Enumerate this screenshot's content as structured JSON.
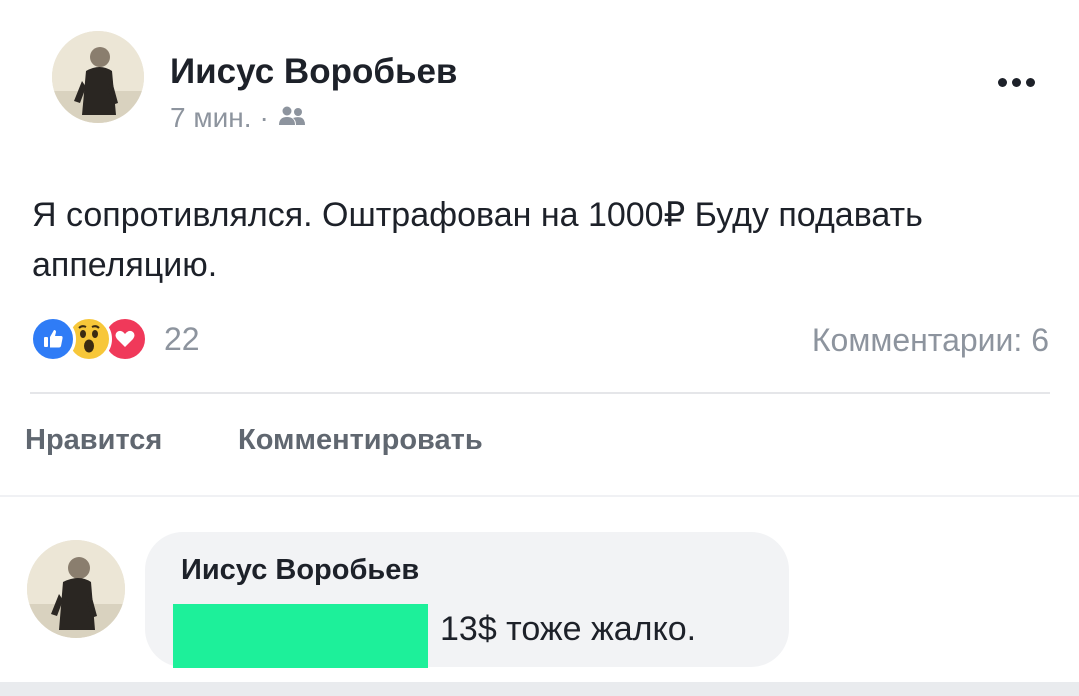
{
  "post": {
    "author_name": "Иисус Воробьев",
    "time": "7 мин.",
    "separator": "·",
    "audience_icon": "friends-icon",
    "more_icon": "more-options-icon",
    "text": "Я сопротивлялся. Оштрафован на 1000₽ Буду подавать аппеляцию.",
    "reactions": {
      "icons": [
        "like-icon",
        "wow-icon",
        "love-icon"
      ],
      "count": "22"
    },
    "comments_label": "Комментарии: 6",
    "actions": {
      "like_label": "Нравится",
      "comment_label": "Комментировать"
    }
  },
  "comment": {
    "author_name": "Иисус Воробьев",
    "text": "13$ тоже жалко.",
    "redaction_color": "#1df09a"
  },
  "colors": {
    "text_primary": "#1d2129",
    "text_secondary": "#8d949e",
    "like_blue": "#2f7cf6",
    "wow_yellow": "#f7c739",
    "love_red": "#f0395a"
  }
}
